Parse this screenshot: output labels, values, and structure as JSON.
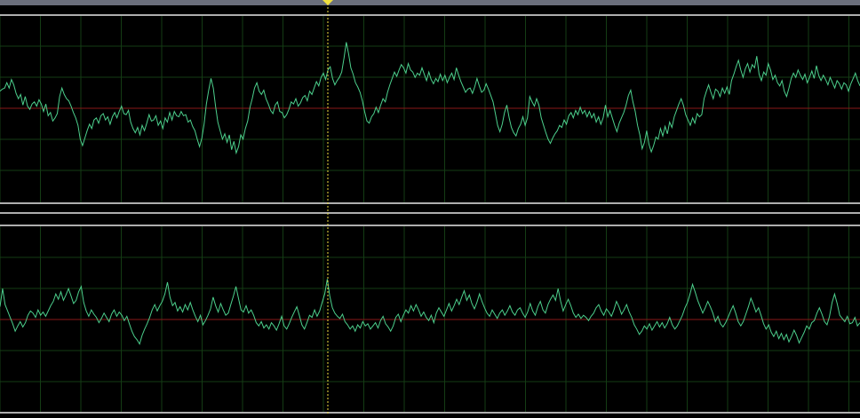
{
  "window": {
    "chrome_color": "#6b6f7c"
  },
  "colors": {
    "background": "#000000",
    "grid": "#143c14",
    "waveform": "#4ccf8c",
    "baseline": "#8a1818",
    "separator": "#e8e8e8",
    "cursor": "#f0e040"
  },
  "icons": {
    "trigger_marker": "yellow-triangle"
  },
  "channels": [
    {
      "id": "upper",
      "trace": [
        1.6,
        1.8,
        1.9,
        2.4,
        1.9,
        2.7,
        2.2,
        1.4,
        0.9,
        1.3,
        0.3,
        1.1,
        0.2,
        -0.1,
        0.4,
        0.6,
        0.2,
        0.8,
        0.4,
        -0.3,
        0.4,
        -0.7,
        -0.4,
        -1.2,
        -0.9,
        -0.5,
        1.1,
        1.9,
        1.3,
        0.9,
        0.7,
        0.2,
        -0.4,
        -0.9,
        -1.6,
        -2.9,
        -3.5,
        -2.8,
        -2.1,
        -1.5,
        -1.9,
        -1.1,
        -0.9,
        -1.4,
        -0.7,
        -0.5,
        -1.1,
        -0.8,
        -1.5,
        -0.8,
        -0.4,
        -0.9,
        -0.3,
        0.2,
        -0.5,
        -0.6,
        -0.2,
        -1.3,
        -1.9,
        -2.3,
        -1.8,
        -2.5,
        -1.6,
        -2.1,
        -1.4,
        -0.6,
        -1.2,
        -1.1,
        -0.7,
        -1.6,
        -1.2,
        -1.9,
        -0.9,
        -1.3,
        -0.4,
        -1.1,
        -0.3,
        -0.7,
        -0.8,
        -0.3,
        -0.7,
        -0.6,
        -1.3,
        -1.1,
        -1.7,
        -2.1,
        -2.9,
        -3.6,
        -2.8,
        -1.5,
        0.4,
        1.7,
        2.8,
        1.9,
        0.2,
        -1.3,
        -2.1,
        -2.9,
        -2.4,
        -3.2,
        -2.5,
        -3.9,
        -3.1,
        -4.2,
        -3.6,
        -2.5,
        -2.9,
        -1.9,
        -1.2,
        0.1,
        0.9,
        1.9,
        2.4,
        1.6,
        1.3,
        1.7,
        0.9,
        0.4,
        -0.2,
        -0.5,
        0.3,
        0.6,
        -0.3,
        -0.4,
        -0.9,
        -0.6,
        -0.1,
        0.6,
        0.4,
        0.9,
        0.2,
        0.5,
        1.0,
        1.2,
        0.7,
        1.6,
        1.3,
        1.9,
        2.5,
        2.1,
        2.9,
        3.3,
        2.7,
        3.6,
        3.9,
        2.8,
        2.2,
        2.6,
        2.9,
        3.4,
        4.7,
        6.2,
        5.1,
        3.8,
        3.2,
        2.4,
        2.0,
        1.5,
        0.7,
        -0.3,
        -1.2,
        -1.4,
        -0.8,
        -0.5,
        0.1,
        -0.4,
        0.3,
        0.9,
        0.6,
        1.5,
        2.2,
        2.8,
        3.4,
        3.0,
        3.6,
        4.1,
        3.8,
        3.3,
        4.2,
        3.6,
        3.4,
        2.9,
        3.3,
        3.1,
        3.8,
        3.2,
        2.6,
        3.4,
        2.7,
        2.3,
        2.8,
        2.5,
        3.2,
        2.6,
        3.1,
        2.4,
        2.9,
        3.3,
        2.7,
        3.8,
        3.1,
        2.5,
        2.0,
        1.5,
        1.8,
        1.9,
        1.4,
        2.0,
        2.8,
        2.1,
        1.5,
        1.7,
        2.3,
        1.8,
        1.2,
        0.6,
        -0.5,
        -1.6,
        -2.2,
        -1.5,
        -0.4,
        0.3,
        -0.9,
        -1.8,
        -2.3,
        -2.6,
        -1.9,
        -1.5,
        -0.8,
        -1.6,
        -0.9,
        1.1,
        0.6,
        0.2,
        0.9,
        0.3,
        -0.9,
        -1.6,
        -2.3,
        -2.9,
        -3.3,
        -2.8,
        -2.4,
        -2.1,
        -1.6,
        -1.8,
        -1.1,
        -1.5,
        -0.7,
        -0.4,
        -0.9,
        -0.2,
        -0.6,
        0.1,
        -0.5,
        -0.2,
        -0.8,
        -0.3,
        -0.9,
        -0.5,
        -1.3,
        -0.8,
        -1.5,
        -0.9,
        0.3,
        -0.8,
        -0.2,
        -0.9,
        -1.6,
        -2.2,
        -1.4,
        -0.9,
        -0.4,
        0.3,
        1.2,
        1.7,
        0.6,
        -0.3,
        -1.6,
        -2.5,
        -3.8,
        -3.2,
        -2.1,
        -3.4,
        -4.1,
        -3.5,
        -2.7,
        -2.9,
        -1.9,
        -2.6,
        -1.7,
        -2.4,
        -1.3,
        -1.8,
        -0.8,
        -0.2,
        0.4,
        0.9,
        0.3,
        -0.6,
        -1.1,
        -1.6,
        -0.9,
        -1.4,
        -0.5,
        -0.8,
        -0.6,
        0.9,
        1.6,
        2.2,
        1.5,
        0.9,
        1.8,
        1.6,
        1.1,
        1.9,
        1.4,
        2.0,
        1.3,
        2.6,
        3.2,
        3.9,
        4.5,
        3.6,
        2.9,
        3.7,
        4.2,
        3.4,
        4.1,
        3.8,
        4.9,
        3.2,
        2.6,
        3.4,
        3.1,
        4.2,
        3.6,
        2.7,
        3.1,
        2.4,
        2.1,
        2.6,
        1.6,
        1.1,
        1.9,
        2.8,
        3.3,
        2.9,
        3.6,
        3.1,
        2.7,
        3.2,
        2.4,
        2.9,
        3.5,
        2.8,
        4.0,
        3.1,
        2.6,
        3.1,
        2.7,
        2.2,
        2.9,
        2.4,
        1.9,
        2.6,
        2.3,
        1.8,
        2.4,
        2.2,
        1.6,
        2.3,
        2.8,
        3.3,
        2.6,
        2.1
      ]
    },
    {
      "id": "lower",
      "trace": [
        1.2,
        2.9,
        1.4,
        0.8,
        0.2,
        -0.4,
        -1.1,
        -0.6,
        -0.2,
        -0.7,
        -0.3,
        0.4,
        0.8,
        0.6,
        0.2,
        0.9,
        0.4,
        0.7,
        0.3,
        0.8,
        1.3,
        1.7,
        2.4,
        1.9,
        2.6,
        1.8,
        2.3,
        2.9,
        2.2,
        1.5,
        1.8,
        2.6,
        3.1,
        1.6,
        0.8,
        0.3,
        0.9,
        0.5,
        0.2,
        -0.3,
        0.1,
        0.6,
        0.2,
        -0.2,
        0.5,
        0.9,
        0.3,
        0.7,
        0.4,
        -0.1,
        0.3,
        -0.4,
        -1.1,
        -1.6,
        -1.9,
        -2.3,
        -1.5,
        -0.9,
        -0.4,
        0.2,
        0.9,
        1.4,
        0.8,
        1.3,
        1.7,
        2.4,
        3.5,
        2.1,
        1.3,
        1.6,
        0.8,
        1.2,
        0.7,
        1.4,
        0.9,
        1.6,
        0.9,
        0.3,
        -0.2,
        0.4,
        -0.5,
        -0.1,
        0.4,
        1.0,
        2.1,
        1.3,
        0.7,
        1.5,
        0.9,
        0.4,
        0.6,
        1.4,
        2.2,
        3.1,
        2.0,
        0.9,
        0.7,
        1.3,
        0.6,
        0.9,
        0.4,
        -0.3,
        -0.6,
        -0.2,
        -0.8,
        -0.5,
        -0.9,
        -0.3,
        -0.6,
        -1.0,
        -0.4,
        0.3,
        -0.6,
        -0.9,
        -0.4,
        0.2,
        0.7,
        1.2,
        0.4,
        -0.5,
        -0.9,
        -0.3,
        0.4,
        0.2,
        0.9,
        0.3,
        0.8,
        1.6,
        2.4,
        3.8,
        2.2,
        1.1,
        0.6,
        0.3,
        0.1,
        0.5,
        -0.2,
        -0.5,
        -0.9,
        -0.6,
        -1.1,
        -0.5,
        -0.8,
        -0.2,
        -0.6,
        -0.4,
        -0.9,
        -0.6,
        -0.3,
        -0.8,
        -0.1,
        0.3,
        -0.4,
        -0.7,
        -1.1,
        -0.6,
        0.2,
        0.5,
        -0.2,
        0.4,
        0.9,
        0.6,
        1.3,
        0.8,
        1.4,
        0.9,
        0.3,
        0.7,
        0.2,
        -0.1,
        0.4,
        -0.3,
        0.6,
        1.1,
        0.7,
        0.3,
        0.9,
        1.5,
        0.8,
        1.3,
        1.9,
        1.4,
        2.1,
        2.7,
        1.8,
        2.3,
        1.5,
        1.0,
        1.6,
        2.4,
        1.7,
        1.1,
        0.6,
        0.3,
        0.9,
        0.5,
        0.1,
        0.6,
        0.9,
        0.4,
        0.8,
        1.3,
        0.7,
        0.4,
        0.9,
        1.1,
        0.6,
        0.2,
        0.7,
        1.5,
        0.8,
        0.4,
        1.2,
        1.7,
        0.9,
        0.6,
        1.4,
        1.9,
        2.3,
        1.8,
        2.9,
        1.7,
        0.8,
        1.4,
        1.9,
        1.3,
        0.6,
        0.2,
        0.5,
        0.1,
        0.4,
        0.2,
        -0.1,
        0.3,
        0.6,
        1.1,
        1.4,
        0.8,
        0.4,
        1.0,
        0.7,
        0.3,
        0.9,
        1.7,
        1.2,
        0.5,
        0.9,
        1.4,
        0.7,
        0.2,
        -0.5,
        -0.9,
        -1.4,
        -1.1,
        -0.6,
        -0.9,
        -0.4,
        -1.0,
        -0.6,
        -0.2,
        -0.7,
        -0.3,
        -0.8,
        -0.4,
        0.2,
        -0.5,
        -0.9,
        -0.6,
        -0.1,
        0.4,
        1.1,
        1.6,
        2.4,
        3.3,
        2.6,
        1.8,
        1.2,
        0.6,
        1.1,
        1.7,
        1.2,
        0.6,
        -0.2,
        0.3,
        -0.4,
        -0.7,
        -0.3,
        0.2,
        0.8,
        1.3,
        0.6,
        -0.2,
        -0.6,
        -0.2,
        0.5,
        1.2,
        2.0,
        1.4,
        0.7,
        1.1,
        0.4,
        -0.4,
        -0.9,
        -0.5,
        -1.2,
        -1.6,
        -1.1,
        -1.8,
        -1.3,
        -1.9,
        -1.4,
        -2.1,
        -1.6,
        -1.0,
        -1.5,
        -2.2,
        -1.7,
        -1.2,
        -0.6,
        -0.9,
        -0.3,
        -0.1,
        0.6,
        1.1,
        0.5,
        -0.2,
        -0.5,
        0.3,
        1.6,
        2.4,
        1.5,
        0.4,
        0.1,
        -0.2,
        0.3,
        -0.4,
        -0.3,
        0.2,
        -0.6,
        -0.3
      ]
    }
  ]
}
